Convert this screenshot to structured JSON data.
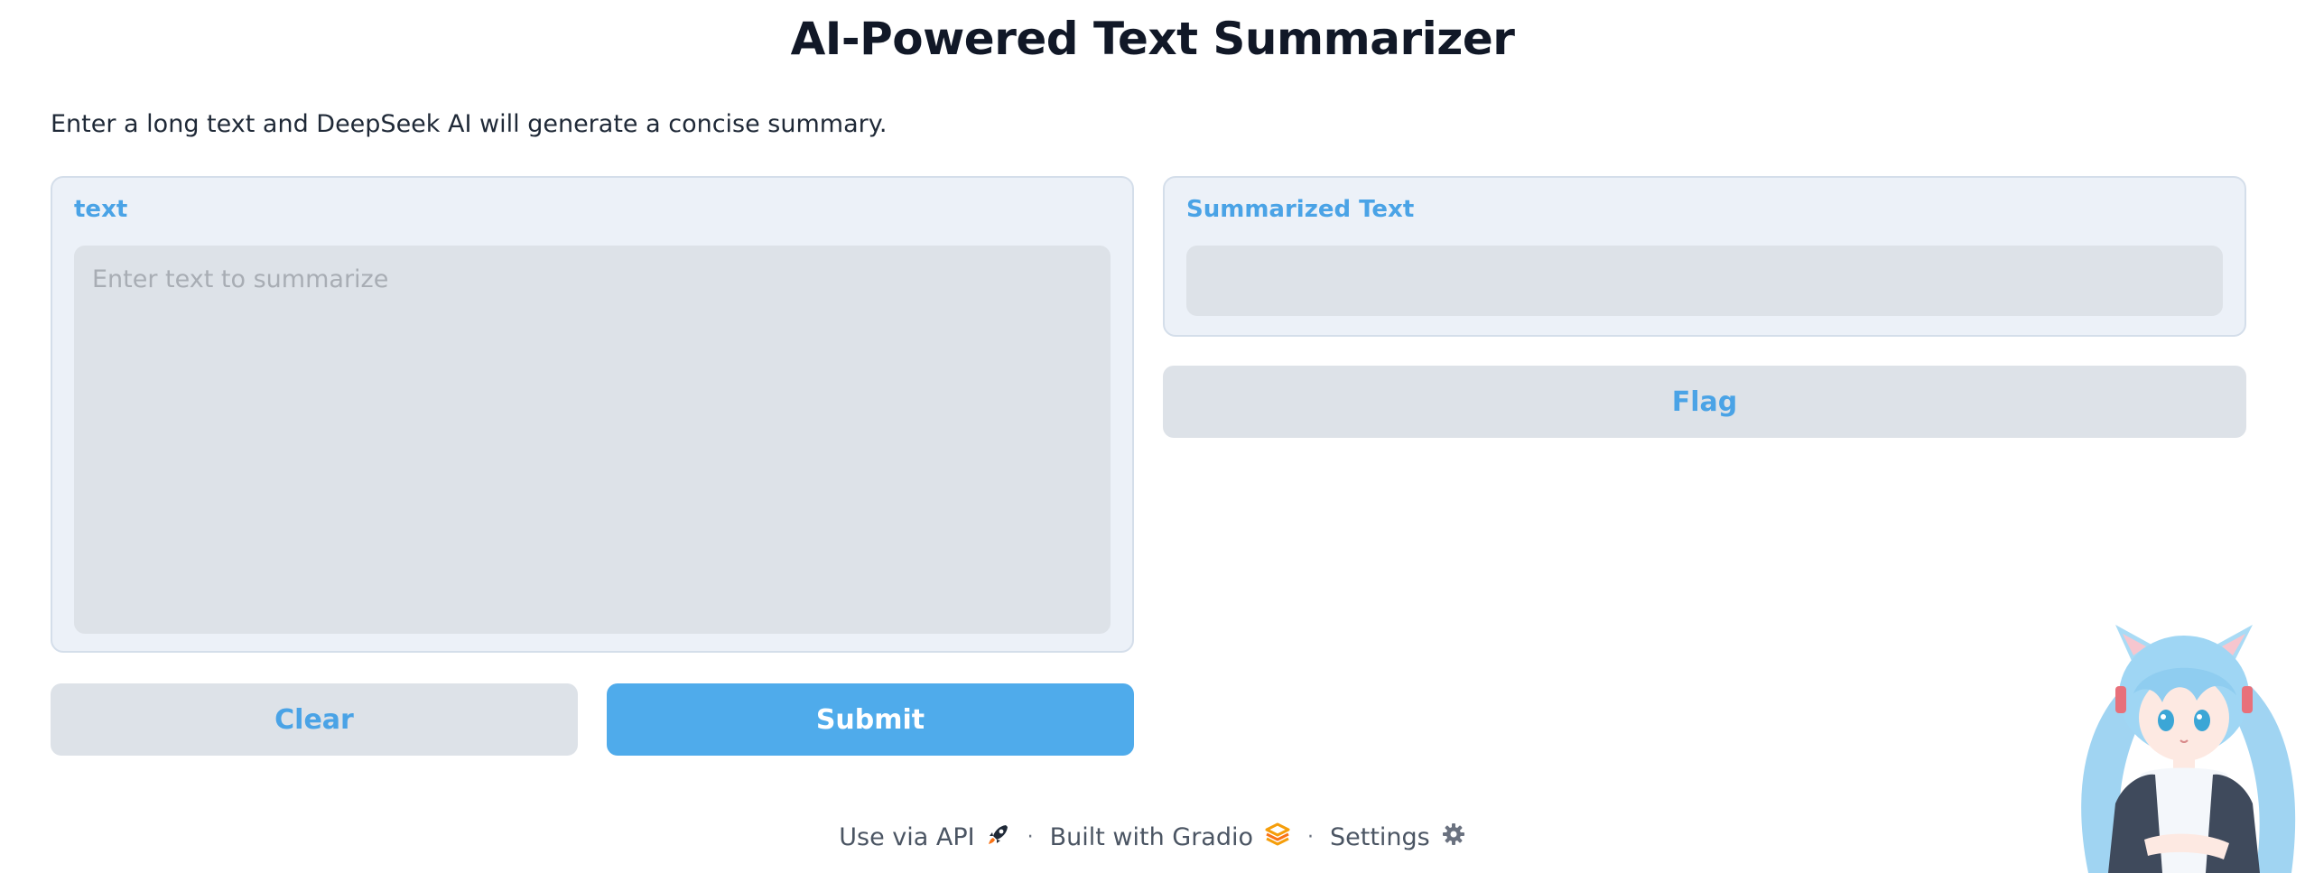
{
  "header": {
    "title": "AI-Powered Text Summarizer",
    "description": "Enter a long text and DeepSeek AI will generate a concise summary."
  },
  "input_panel": {
    "label": "text",
    "value": "",
    "placeholder": "Enter text to summarize"
  },
  "output_panel": {
    "label": "Summarized Text",
    "value": ""
  },
  "buttons": {
    "flag_label": "Flag",
    "clear_label": "Clear",
    "submit_label": "Submit"
  },
  "footer": {
    "api_label": "Use via API",
    "api_icon": "rocket-icon",
    "built_label": "Built with Gradio",
    "built_icon": "gradio-logo-icon",
    "settings_label": "Settings",
    "settings_icon": "gear-icon",
    "separator": "·"
  },
  "decoration": {
    "mascot": "anime-girl-illustration"
  },
  "colors": {
    "accent": "#4fabeb",
    "label_blue": "#4aa3e6",
    "panel_bg": "#ecf1f8",
    "field_bg": "#dde2e8"
  }
}
